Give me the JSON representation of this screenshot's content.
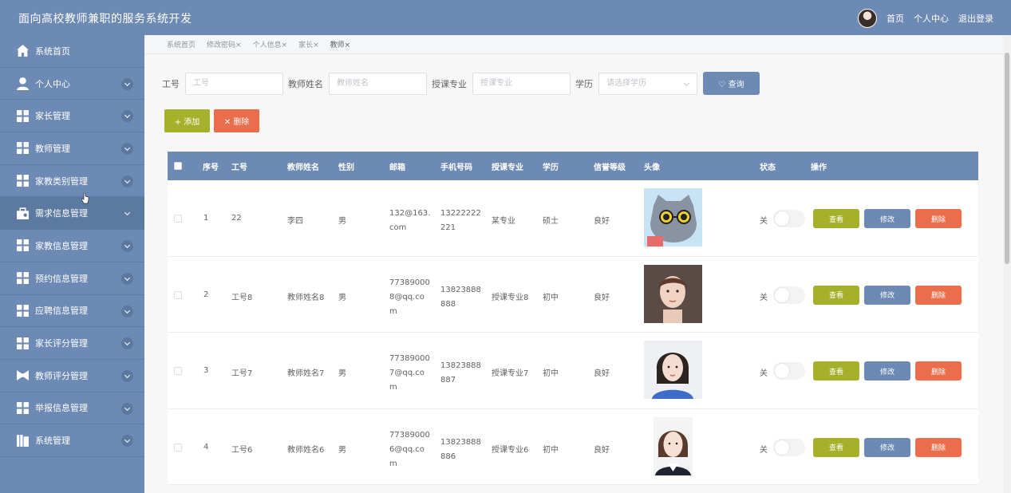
{
  "app": {
    "title": "面向高校教师兼职的服务系统开发"
  },
  "header": {
    "links": [
      "首页",
      "个人中心",
      "退出登录"
    ]
  },
  "sidebar": {
    "items": [
      {
        "label": "系统首页",
        "icon": "home-icon"
      },
      {
        "label": "个人中心",
        "icon": "person-icon"
      },
      {
        "label": "家长管理",
        "icon": "grid-icon"
      },
      {
        "label": "教师管理",
        "icon": "grid-icon"
      },
      {
        "label": "家教类别管理",
        "icon": "grid-icon"
      },
      {
        "label": "需求信息管理",
        "icon": "briefcase-icon"
      },
      {
        "label": "家教信息管理",
        "icon": "grid-icon"
      },
      {
        "label": "预约信息管理",
        "icon": "grid-icon"
      },
      {
        "label": "应聘信息管理",
        "icon": "grid-icon"
      },
      {
        "label": "家长评分管理",
        "icon": "grid-icon"
      },
      {
        "label": "教师评分管理",
        "icon": "bowtie-icon"
      },
      {
        "label": "举报信息管理",
        "icon": "grid-icon"
      },
      {
        "label": "系统管理",
        "icon": "book-icon"
      }
    ]
  },
  "tabs": [
    "系统首页",
    "修改密码×",
    "个人信息×",
    "家长×",
    "教师×"
  ],
  "search": {
    "gonghao_label": "工号",
    "gonghao_placeholder": "工号",
    "name_label": "教师姓名",
    "name_placeholder": "教师姓名",
    "major_label": "授课专业",
    "major_placeholder": "授课专业",
    "edu_label": "学历",
    "edu_placeholder": "请选择学历",
    "query_label": "♡ 查询"
  },
  "actions": {
    "add_label": "+ 添加",
    "delete_label": "✕ 删除"
  },
  "table": {
    "columns": [
      "序号",
      "工号",
      "教师姓名",
      "性别",
      "邮箱",
      "手机号码",
      "授课专业",
      "学历",
      "信誉等级",
      "头像",
      "状态",
      "操作"
    ],
    "rows": [
      {
        "index": "1",
        "gonghao": "22",
        "name": "李四",
        "gender": "男",
        "email": [
          "132@163.",
          "com"
        ],
        "phone": [
          "13222222",
          "221"
        ],
        "major": "某专业",
        "edu": "硕士",
        "credit": "良好",
        "status": "关",
        "avatar": "cat"
      },
      {
        "index": "2",
        "gonghao": "工号8",
        "name": "教师姓名8",
        "gender": "男",
        "email": [
          "77389000",
          "8@qq.co",
          "m"
        ],
        "phone": [
          "13823888",
          "888"
        ],
        "major": "授课专业8",
        "edu": "初中",
        "credit": "良好",
        "status": "关",
        "avatar": "woman1"
      },
      {
        "index": "3",
        "gonghao": "工号7",
        "name": "教师姓名7",
        "gender": "男",
        "email": [
          "77389000",
          "7@qq.co",
          "m"
        ],
        "phone": [
          "13823888",
          "887"
        ],
        "major": "授课专业7",
        "edu": "初中",
        "credit": "良好",
        "status": "关",
        "avatar": "woman2"
      },
      {
        "index": "4",
        "gonghao": "工号6",
        "name": "教师姓名6",
        "gender": "男",
        "email": [
          "77389000",
          "6@qq.co",
          "m"
        ],
        "phone": [
          "13823888",
          "886"
        ],
        "major": "授课专业6",
        "edu": "初中",
        "credit": "良好",
        "status": "关",
        "avatar": "woman3"
      }
    ],
    "row_buttons": {
      "view": "查看",
      "edit": "修改",
      "delete": "删除"
    }
  },
  "colors": {
    "primary": "#6d8ab4",
    "olive": "#a5b12a",
    "danger": "#ea6e4b"
  }
}
